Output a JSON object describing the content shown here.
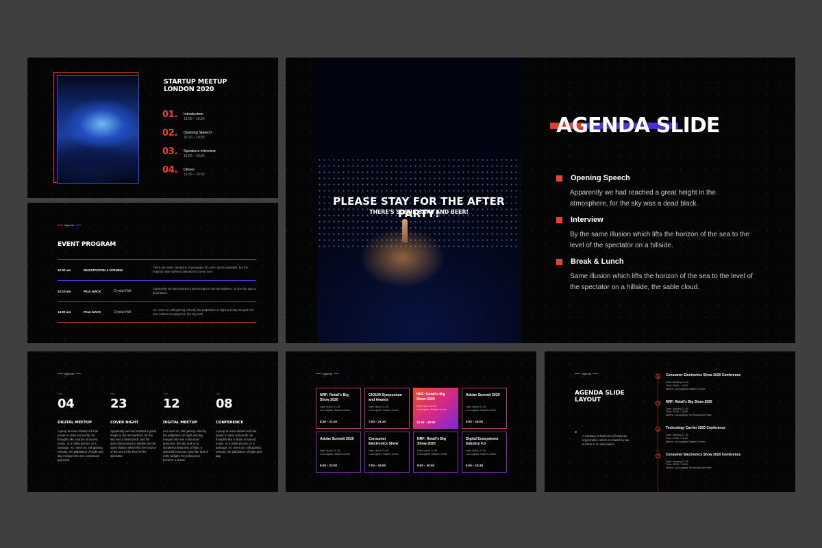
{
  "slide1": {
    "title_line1": "STARTUP MEETUP",
    "title_line2": "LONDON 2020",
    "agenda": [
      {
        "num": "01.",
        "label": "Introduction",
        "time": "18:00 – 18:20"
      },
      {
        "num": "02.",
        "label": "Opening Speech",
        "time": "18:20 – 18:00"
      },
      {
        "num": "03.",
        "label": "Speakers Interview",
        "time": "19:00 – 19:30"
      },
      {
        "num": "04.",
        "label": "Dinner",
        "time": "19:30 – 20:30"
      }
    ]
  },
  "slide2": {
    "tag": "Agenda",
    "title": "EVENT PROGRAM",
    "rows": [
      {
        "time": "10:30 am",
        "who": "REGISTRATION & OPENING",
        "where": "",
        "desc": "There are many variations of passages of Lorem Ipsum available, but the majority have suffered alteration in some form."
      },
      {
        "time": "12:10 am",
        "who": "PAUL MACK",
        "where": "Crystal Hall",
        "desc": "Apparently we had reached a great height in the atmosphere, for the sky was a dead black."
      },
      {
        "time": "14:00 am",
        "who": "PAUL MACK",
        "where": "Crystal Hall",
        "desc": "As I went on, still gaining velocity, the palpitation of night and day merged into one continuous greyness, the sky took."
      }
    ]
  },
  "slide3": {
    "photo_text": "PLEASE STAY FOR THE AFTER PARTY!",
    "photo_subtext": "THERE'S SUSHI, SAKE AND BEER!",
    "heading": "AGENDA SLIDE",
    "items": [
      {
        "title": "Opening Speech",
        "body": "Apparently we had reached a great height in the atmosphere, for the sky was a dead black."
      },
      {
        "title": "Interview",
        "body": "By the same illusion which lifts the horizon of the sea to the level of the spectator on a hillside."
      },
      {
        "title": "Break & Lunch",
        "body": "Same illusion which lifts the horizon of the sea to the level of the spectator on a hillside, the sable cloud."
      }
    ]
  },
  "slide4": {
    "tag": "Agenda",
    "cols": [
      {
        "month": "May",
        "day": "04",
        "title": "DIGITAL MEETUP",
        "body": "A peep at some distant orb has power to raise and purify our thoughts like a strain of sacred music, or a noble picture, or a passage. As I went on, still gaining velocity, the palpitation of night and day merged into one continuous greyness."
      },
      {
        "month": "May",
        "day": "23",
        "title": "COVER NIGHT",
        "body": "Apparently we had reached a great height in the atmosphere, for the sky was a dead black, and the stars had ceased to twinkle. By the same illusion which lifts the horizon of the sea to the level of the spectator."
      },
      {
        "month": "June",
        "day": "12",
        "title": "DIGITAL MEETUP",
        "body": "As I went on, still gaining velocity, the palpitation of night and day merged into one continuous greyness; the sky took on a wonderful deepness of blue, a splendid luminous color like that of early twilight; the jerking sun became a streak."
      },
      {
        "month": "July",
        "day": "08",
        "title": "CONFERENCE",
        "body": "A peep at some distant orb has power to raise and purify our thoughts like a strain of sacred music, or a noble picture, or a passage. As I went on, still gaining velocity, the palpitation of night and day."
      }
    ]
  },
  "slide5": {
    "tag": "Agenda",
    "cards": [
      {
        "title": "NRF: Retail's Big Show 2020",
        "date": "Date: March 21-28",
        "place": "Los Angeles, Staples Center",
        "time": "8:30 – 21:20",
        "highlight": false
      },
      {
        "title": "CIO100 Symposium and Awards",
        "date": "Date: March 21-28",
        "place": "Los Angeles, Staples Center",
        "time": "7:00 – 21:30",
        "highlight": false
      },
      {
        "title": "NRF: Retail's Big Show 2020",
        "date": "Date: March 21-28",
        "place": "Los Angeles, Staples Center",
        "time": "10:00 – 18:00",
        "highlight": true
      },
      {
        "title": "Adobe Summit 2020",
        "date": "Date: March 21-28",
        "place": "Los Angeles, Staples Center",
        "time": "9:00 – 16:00",
        "highlight": false
      },
      {
        "title": "Adobe Summit 2020",
        "date": "Date: March 21-28",
        "place": "Los Angeles, Staples Center",
        "time": "8:00 – 22:00",
        "highlight": false
      },
      {
        "title": "Consumer Electronics Show",
        "date": "Date: March 21-28",
        "place": "Los Angeles, Staples Center",
        "time": "7:00 – 19:00",
        "highlight": false
      },
      {
        "title": "NRF: Retail's Big Show 2020",
        "date": "Date: March 21-28",
        "place": "Los Angeles, Staples Center",
        "time": "8:00 – 20:00",
        "highlight": false
      },
      {
        "title": "Digital Ecosystems Industry 4.0",
        "date": "Date: March 21-28",
        "place": "Los Angeles, Staples Center",
        "time": "6:00 – 15:30",
        "highlight": false
      }
    ]
  },
  "slide6": {
    "tag": "Agenda",
    "title_line1": "AGENDA SLIDE",
    "title_line2": "LAYOUT",
    "description": "A company is that form of business organization, which is created by law. It refers to an association.",
    "timeline": [
      {
        "title": "Consumer Electronics Show 2020 Conference",
        "date": "Date: January 21-25",
        "time": "Time: 09:00 – 18:00",
        "where": "Where: Los Angeles Staples Center"
      },
      {
        "title": "NRF: Retail's Big Show 2020",
        "date": "Date: January 21-25",
        "time": "Time: 09:00 – 18:00",
        "where": "Where: Los Angeles The Mosaic Art Hotel"
      },
      {
        "title": "Technology Carrier 2020 Conference",
        "date": "Date: January 21-25",
        "time": "Time: 09:00 – 18:00",
        "where": "Where: Los Angeles Staples Center"
      },
      {
        "title": "Consumer Electronics Show 2020 Conference",
        "date": "Date: January 21-25",
        "time": "Time: 09:00 – 18:00",
        "where": "Where: Los Angeles The Mosaic Art Hotel"
      }
    ]
  }
}
